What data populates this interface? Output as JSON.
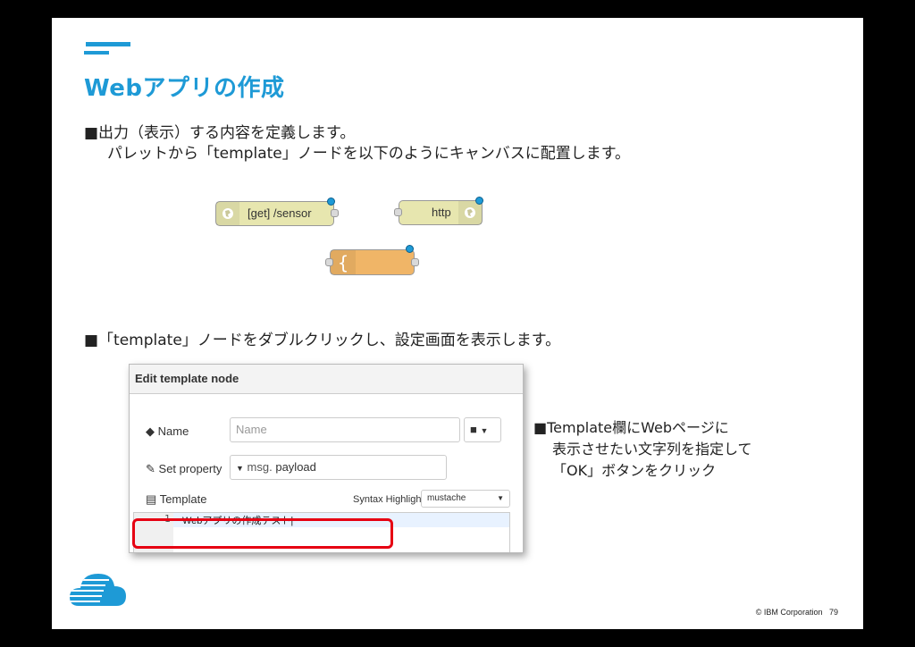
{
  "slide": {
    "title": "Webアプリの作成",
    "bullet1_line1": "■出力（表示）する内容を定義します。",
    "bullet1_line2": "パレットから「template」ノードを以下のようにキャンバスに配置します。",
    "bullet2": "■「template」ノードをダブルクリックし、設定画面を表示します。",
    "note_line1": "■Template欄にWebページに",
    "note_line2": "表示させたい文字列を指定して",
    "note_line3": "「OK」ボタンをクリック",
    "footer_copyright": "© IBM Corporation",
    "page_number": "79"
  },
  "nodes": {
    "http_in_label": "[get] /sensor",
    "http_response_label": "http",
    "template_icon": "{",
    "colors": {
      "http": "#e7e6af",
      "template": "#f0b567",
      "changed_dot": "#1e9ad6"
    }
  },
  "dialog": {
    "title": "Edit template node",
    "name_label": "Name",
    "name_placeholder": "Name",
    "set_property_label": "Set property",
    "property_prefix": "msg.",
    "property_value": "payload",
    "template_label": "Template",
    "syntax_label": "Syntax Highlight:",
    "syntax_value": "mustache",
    "line_number": "1",
    "code_text": "Webアプリの作成テスト|"
  },
  "icons": [
    "tag-icon",
    "edit-icon",
    "file-icon",
    "book-icon",
    "caret-down-icon",
    "globe-icon",
    "cloud-logo"
  ]
}
